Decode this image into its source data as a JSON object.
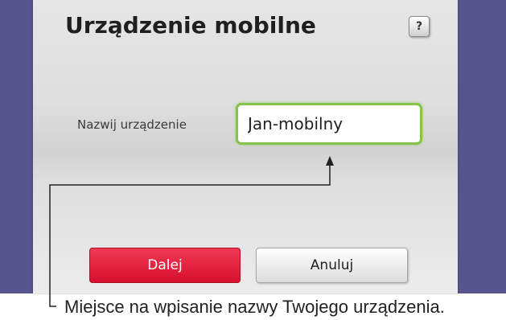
{
  "dialog": {
    "title": "Urządzenie mobilne",
    "help_label": "?",
    "field_label": "Nazwij urządzenie",
    "device_name_value": "Jan-mobilny",
    "next_label": "Dalej",
    "cancel_label": "Anuluj"
  },
  "annotation": {
    "caption": "Miejsce na wpisanie nazwy Twojego urządzenia."
  },
  "colors": {
    "background_frame": "#57558f",
    "input_focus_border": "#84c44a",
    "primary_button": "#e4163a"
  },
  "icons": {
    "help": "question-mark-icon",
    "callout": "arrow-up-icon"
  }
}
